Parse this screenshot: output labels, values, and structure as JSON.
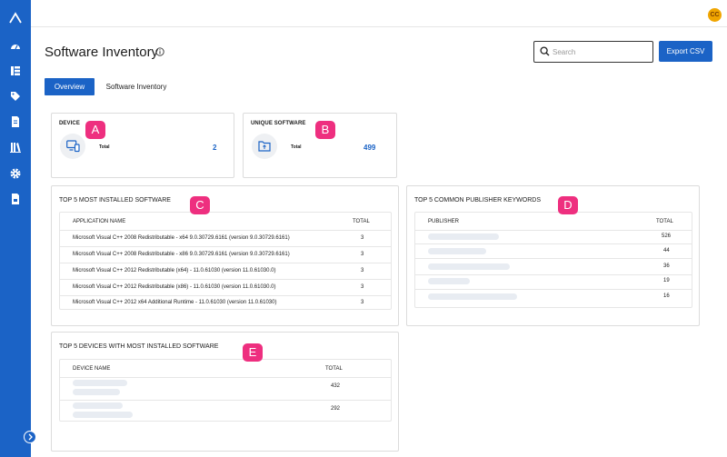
{
  "user": {
    "initials": "CC"
  },
  "page": {
    "title": "Software Inventory"
  },
  "search": {
    "placeholder": "Search"
  },
  "toolbar": {
    "export_label": "Export CSV"
  },
  "tabs": [
    {
      "label": "Overview",
      "active": true
    },
    {
      "label": "Software Inventory",
      "active": false
    }
  ],
  "device_card": {
    "title": "DEVICE",
    "label": "Total",
    "value": "2",
    "marker": "A"
  },
  "software_card": {
    "title": "UNIQUE SOFTWARE",
    "label": "Total",
    "value": "499",
    "marker": "B"
  },
  "top_software": {
    "title": "TOP 5 MOST INSTALLED SOFTWARE",
    "marker": "C",
    "col_name": "APPLICATION NAME",
    "col_total": "TOTAL",
    "rows": [
      {
        "name": "Microsoft Visual C++ 2008 Redistributable - x64 9.0.30729.6161 (version 9.0.30729.6161)",
        "total": "3"
      },
      {
        "name": "Microsoft Visual C++ 2008 Redistributable - x86 9.0.30729.6161 (version 9.0.30729.6161)",
        "total": "3"
      },
      {
        "name": "Microsoft Visual C++ 2012 Redistributable (x64) - 11.0.61030 (version 11.0.61030.0)",
        "total": "3"
      },
      {
        "name": "Microsoft Visual C++ 2012 Redistributable (x86) - 11.0.61030 (version 11.0.61030.0)",
        "total": "3"
      },
      {
        "name": "Microsoft Visual C++ 2012 x64 Additional Runtime - 11.0.61030 (version 11.0.61030)",
        "total": "3"
      }
    ]
  },
  "top_publishers": {
    "title": "TOP 5 COMMON PUBLISHER KEYWORDS",
    "marker": "D",
    "col_name": "PUBLISHER",
    "col_total": "TOTAL",
    "rows": [
      {
        "total": "526"
      },
      {
        "total": "44"
      },
      {
        "total": "36"
      },
      {
        "total": "19"
      },
      {
        "total": "16"
      }
    ]
  },
  "top_devices": {
    "title": "TOP 5 DEVICES WITH MOST INSTALLED SOFTWARE",
    "marker": "E",
    "col_name": "DEVICE NAME",
    "col_total": "TOTAL",
    "rows": [
      {
        "total": "432"
      },
      {
        "total": "292"
      }
    ]
  },
  "sidebar": {
    "icons": [
      "logo-icon",
      "dashboard-icon",
      "list-icon",
      "tag-icon",
      "document-icon",
      "library-icon",
      "gear-icon",
      "report-icon"
    ]
  },
  "colors": {
    "accent": "#1b63c6",
    "marker": "#ee2f7f",
    "avatar": "#f0a500"
  }
}
